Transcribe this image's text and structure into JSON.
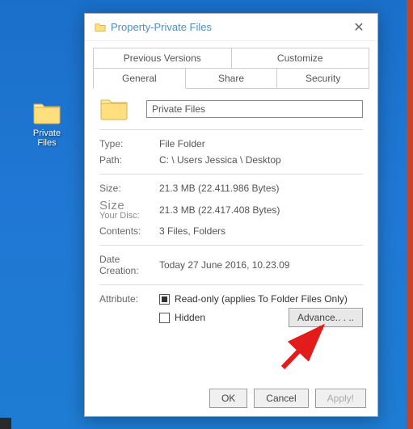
{
  "desktop": {
    "icon_label": "Private Files"
  },
  "dialog": {
    "title": "Property-Private Files",
    "tabs_top": [
      "Previous Versions",
      "Customize"
    ],
    "tabs_bottom": [
      "General",
      "Share",
      "Security"
    ],
    "name_value": "Private Files",
    "rows": {
      "type_label": "Type:",
      "type_value": "File Folder",
      "path_label": "Path:",
      "path_value": "C: \\ Users Jessica \\ Desktop",
      "size_label": "Size:",
      "size_value": "21.3 MB (22.411.986 Bytes)",
      "disc_label_big": "Size",
      "disc_label_small": "Your Disc:",
      "disc_value": "21.3 MB (22.417.408 Bytes)",
      "contents_label": "Contents:",
      "contents_value": "3 Files, Folders",
      "date_label_line1": "Date",
      "date_label_line2": "Creation:",
      "date_value": "Today 27 June 2016, 10.23.09",
      "attr_label": "Attribute:",
      "attr_readonly": "Read-only (applies To Folder Files Only)",
      "attr_hidden": "Hidden"
    },
    "buttons": {
      "advance": "Advance.. . ..",
      "ok": "OK",
      "cancel": "Cancel",
      "apply": "Apply!"
    }
  }
}
